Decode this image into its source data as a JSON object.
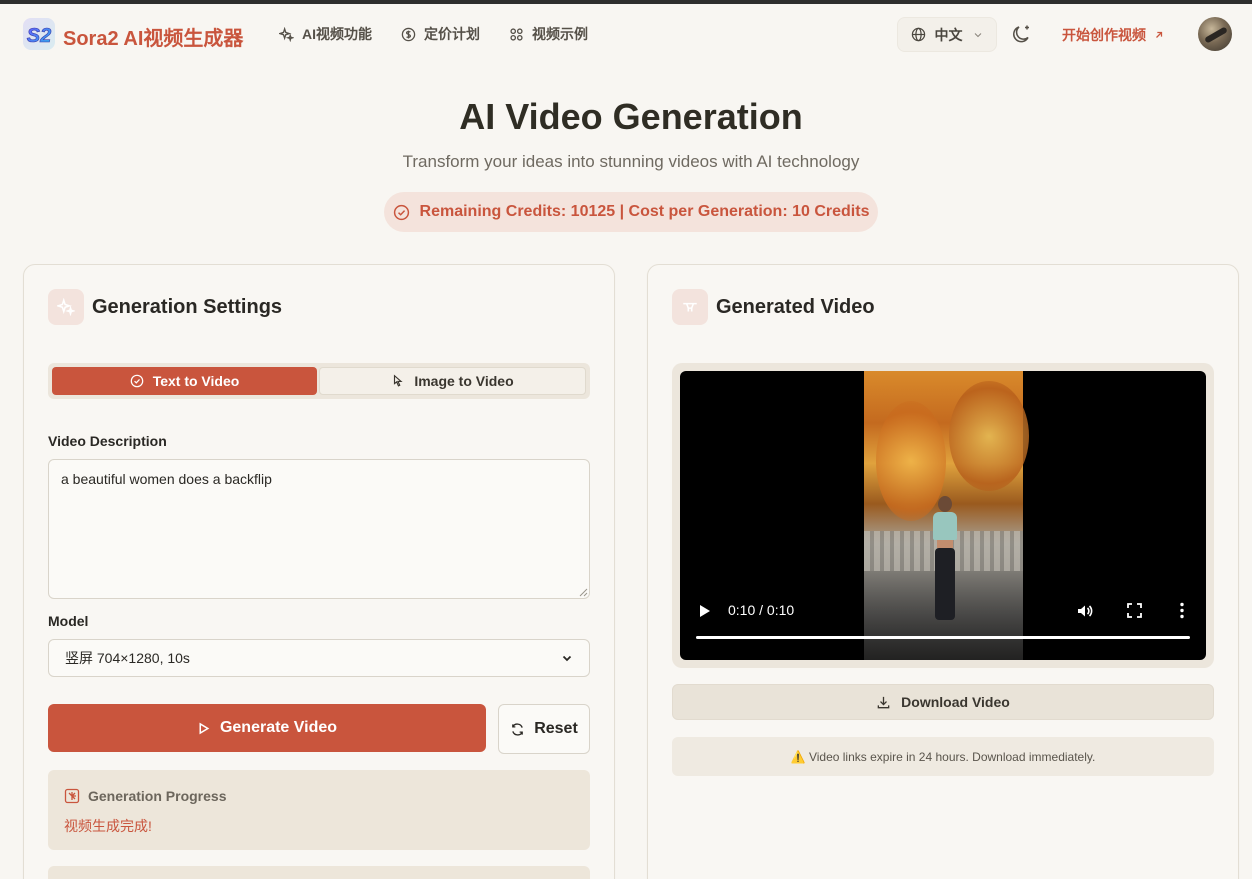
{
  "header": {
    "brand": "Sora2 AI视频生成器",
    "logo_text": "S2",
    "nav": [
      {
        "label": "AI视频功能",
        "icon": "sparkles-icon"
      },
      {
        "label": "定价计划",
        "icon": "dollar-circle-icon"
      },
      {
        "label": "视频示例",
        "icon": "grid-icon"
      }
    ],
    "language": "中文",
    "cta": "开始创作视频"
  },
  "hero": {
    "title": "AI Video Generation",
    "subtitle": "Transform your ideas into stunning videos with AI technology",
    "credits": "Remaining Credits: 10125 | Cost per Generation: 10 Credits"
  },
  "settings": {
    "title": "Generation Settings",
    "tabs": {
      "text_to_video": "Text to Video",
      "image_to_video": "Image to Video"
    },
    "description_label": "Video Description",
    "description_value": "a beautiful women does a backflip",
    "model_label": "Model",
    "model_value": "竖屏 704×1280, 10s",
    "generate_label": "Generate Video",
    "reset_label": "Reset",
    "progress_title": "Generation Progress",
    "progress_status": "视频生成完成!"
  },
  "output": {
    "title": "Generated Video",
    "time": "0:10 / 0:10",
    "download_label": "Download Video",
    "notice": "⚠️ Video links expire in 24 hours. Download immediately."
  },
  "colors": {
    "accent": "#c9553d",
    "background": "#f8f6f2"
  }
}
